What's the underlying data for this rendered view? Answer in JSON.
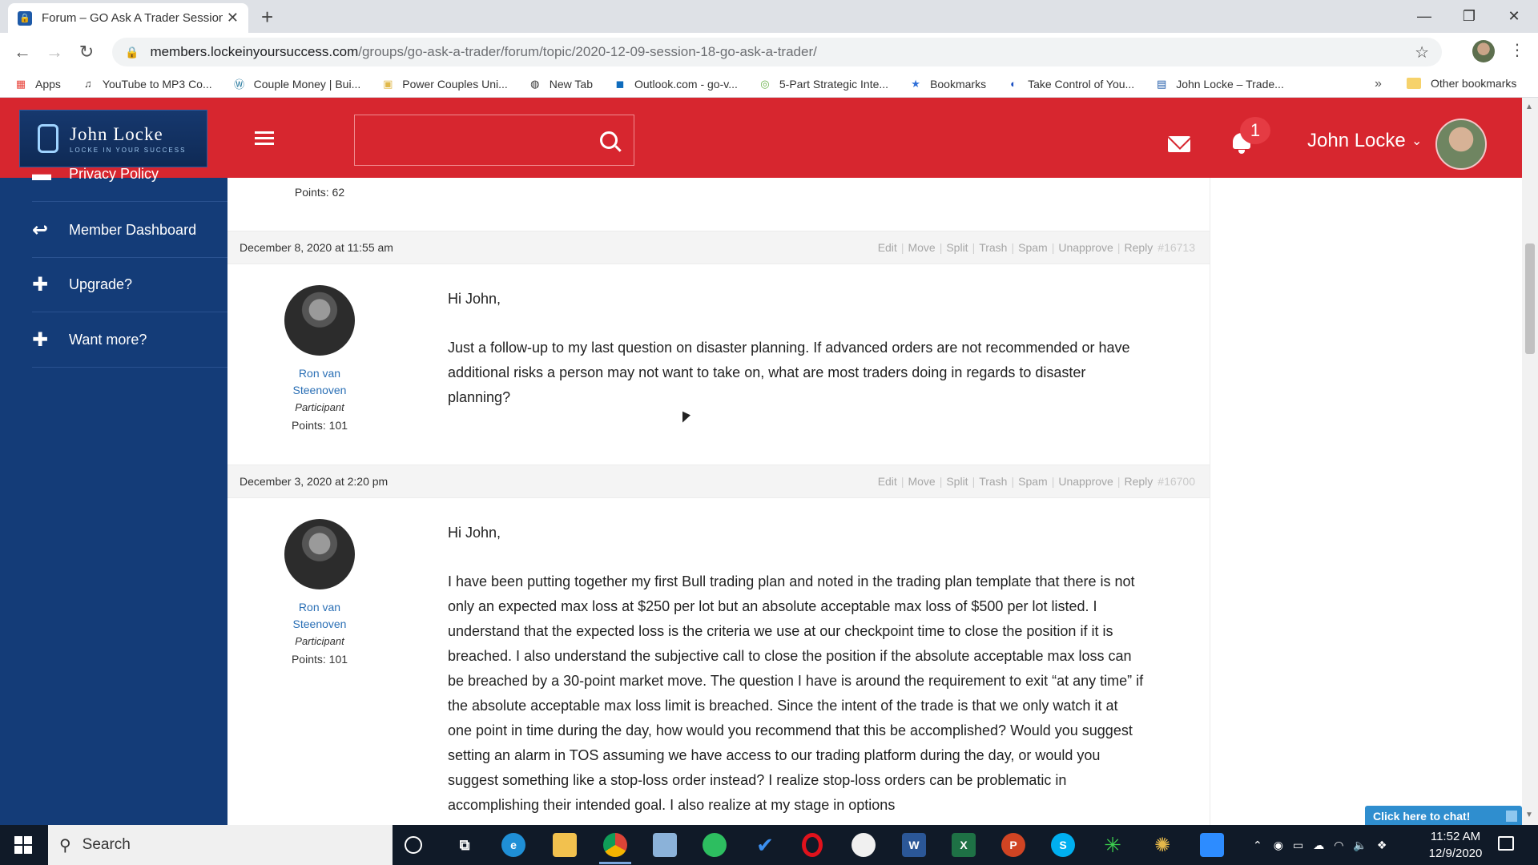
{
  "browser": {
    "tab_title": "Forum – GO Ask A Trader Session",
    "url_host": "members.lockeinyoursuccess.com",
    "url_path": "/groups/go-ask-a-trader/forum/topic/2020-12-09-session-18-go-ask-a-trader/",
    "bookmarks": [
      {
        "label": "Apps",
        "icon": "apps-grid-icon"
      },
      {
        "label": "YouTube to MP3 Co...",
        "icon": "music-note-icon"
      },
      {
        "label": "Couple Money | Bui...",
        "icon": "wordpress-icon"
      },
      {
        "label": "Power Couples Uni...",
        "icon": "bookmark-page-icon"
      },
      {
        "label": "New Tab",
        "icon": "globe-icon"
      },
      {
        "label": "Outlook.com - go-v...",
        "icon": "outlook-icon"
      },
      {
        "label": "5-Part Strategic Inte...",
        "icon": "circle-logo-icon"
      },
      {
        "label": "Bookmarks",
        "icon": "star-icon"
      },
      {
        "label": "Take Control of You...",
        "icon": "blue-swirl-icon"
      },
      {
        "label": "John Locke – Trade...",
        "icon": "lock-logo-icon"
      }
    ],
    "bookmarks_more": "»",
    "other_bookmarks": "Other bookmarks"
  },
  "header": {
    "logo_text": "John Locke",
    "logo_tagline": "LOCKE IN YOUR SUCCESS",
    "notification_count": "1",
    "user_name": "John Locke"
  },
  "sidebar": {
    "items": [
      {
        "label": "Privacy Policy",
        "icon": "document-icon"
      },
      {
        "label": "Member Dashboard",
        "icon": "reply-arrow-icon"
      },
      {
        "label": "Upgrade?",
        "icon": "plus-icon"
      },
      {
        "label": "Want more?",
        "icon": "plus-icon"
      }
    ]
  },
  "forum": {
    "top_post": {
      "role": "Participant",
      "points": "Points: 62"
    },
    "admin_links": [
      "Edit",
      "Move",
      "Split",
      "Trash",
      "Spam",
      "Unapprove",
      "Reply"
    ],
    "replies": [
      {
        "date": "December 8, 2020 at 11:55 am",
        "id": "#16713",
        "author_first": "Ron van",
        "author_last": "Steenoven",
        "role": "Participant",
        "points": "Points: 101",
        "paragraphs": [
          "Hi John,",
          "Just a follow-up to my last question on disaster planning. If advanced orders are not recommended or have additional risks a person may not want to take on, what are most traders doing in regards to disaster planning?"
        ]
      },
      {
        "date": "December 3, 2020 at 2:20 pm",
        "id": "#16700",
        "author_first": "Ron van",
        "author_last": "Steenoven",
        "role": "Participant",
        "points": "Points: 101",
        "paragraphs": [
          "Hi John,",
          "I have been putting together my first Bull trading plan and noted in the trading plan template that there is not only an expected max loss at $250 per lot but an absolute acceptable max loss of $500 per lot listed. I understand that the expected loss is the criteria we use at our checkpoint time to close the position if it is breached. I also understand the subjective call to close the position if the absolute acceptable max loss can be breached by a 30-point market move. The question I have is around the requirement to exit “at any time” if the absolute acceptable max loss limit is breached. Since the intent of the trade is that we only watch it at one point in time during the day, how would you recommend that this be accomplished? Would you suggest setting an alarm in TOS assuming we have access to our trading platform during the day, or would you suggest something like a stop-loss order instead? I realize stop-loss orders can be problematic in accomplishing their intended goal. I also realize at my stage in options"
        ]
      }
    ]
  },
  "chat": {
    "label": "Click here to chat!"
  },
  "taskbar": {
    "search_label": "Search",
    "time": "11:52 AM",
    "date": "12/9/2020",
    "apps": [
      "cortana-icon",
      "task-view-icon",
      "edge-icon",
      "file-explorer-icon",
      "chrome-icon",
      "notepad-icon",
      "evernote-icon",
      "todo-icon",
      "opera-icon",
      "photos-icon",
      "word-icon",
      "excel-icon",
      "powerpoint-icon",
      "skype-icon",
      "spark-icon",
      "ant-icon",
      "zoom-icon"
    ]
  }
}
